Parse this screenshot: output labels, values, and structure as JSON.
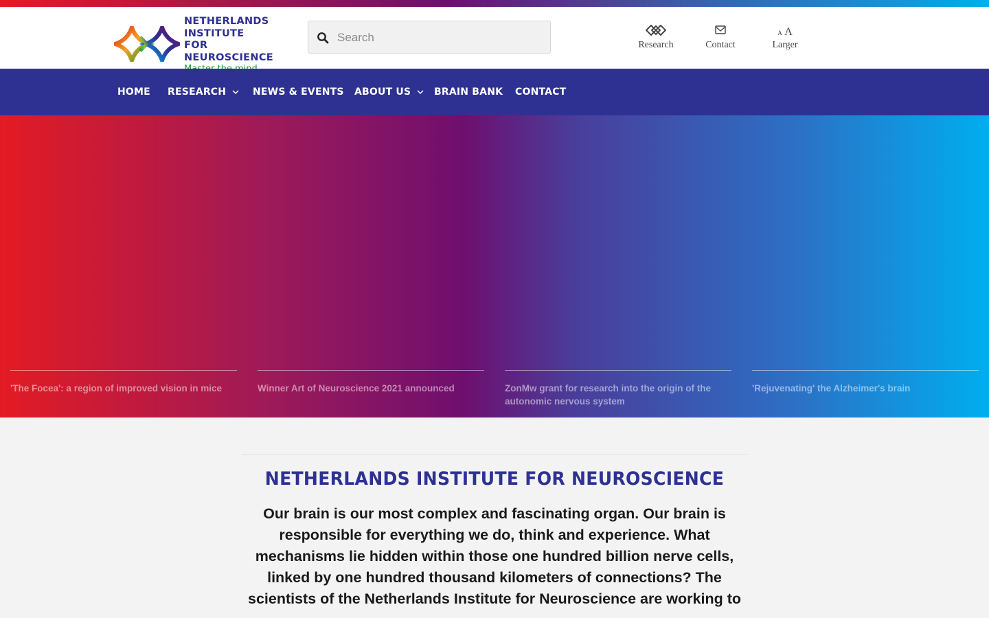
{
  "colors": {
    "brand_blue": "#2e3192",
    "brand_green": "#1a9b3c",
    "hero_gradient": [
      "#e31b23",
      "#6e0f6e",
      "#00aeef"
    ]
  },
  "header": {
    "logo": {
      "lines": [
        "NETHERLANDS",
        "INSTITUTE",
        "FOR NEUROSCIENCE"
      ],
      "tagline": "Master the mind"
    },
    "search": {
      "placeholder": "Search",
      "value": ""
    },
    "utilities": [
      {
        "icon": "research-diamonds-icon",
        "label": "Research"
      },
      {
        "icon": "envelope-icon",
        "label": "Contact"
      },
      {
        "icon_text_small": "A",
        "icon_text_large": "A",
        "label": "Larger"
      }
    ]
  },
  "nav": {
    "items": [
      {
        "label": "HOME",
        "has_dropdown": false
      },
      {
        "label": "RESEARCH",
        "has_dropdown": true
      },
      {
        "label": "NEWS & EVENTS",
        "has_dropdown": false
      },
      {
        "label": "ABOUT US",
        "has_dropdown": true
      },
      {
        "label": "BRAIN BANK",
        "has_dropdown": false
      },
      {
        "label": "CONTACT",
        "has_dropdown": false
      }
    ]
  },
  "hero": {
    "news": [
      {
        "title": "'The Focea': a region of improved vision in mice"
      },
      {
        "title": "Winner Art of Neuroscience 2021 announced"
      },
      {
        "title": "ZonMw grant for research into the origin of the autonomic nervous system"
      },
      {
        "title": "'Rejuvenating' the Alzheimer's brain"
      }
    ]
  },
  "intro": {
    "title": "NETHERLANDS INSTITUTE FOR NEUROSCIENCE",
    "text": "Our brain is our most complex and fascinating organ. Our brain is responsible for everything we do, think and experience. What mechanisms lie hidden within those one hundred billion nerve cells, linked by one hundred thousand kilometers of connections? The scientists of the Netherlands Institute for Neuroscience are working to"
  }
}
